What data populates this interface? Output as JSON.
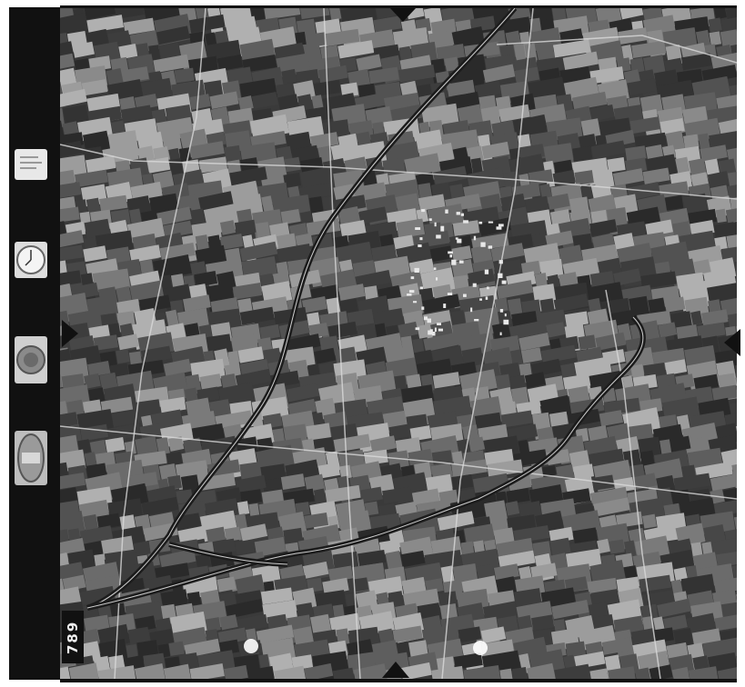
{
  "photo": {
    "frame_number": "789",
    "description_colors": {
      "film": "#111111",
      "field_dark": "#2b2b2b",
      "field_light": "#8c8c8c",
      "canal": "#1c1c1c"
    }
  },
  "instruments": {
    "label_card": "",
    "clock": "clock-icon",
    "altimeter": "altimeter-icon",
    "level": "level-bubble-icon"
  }
}
